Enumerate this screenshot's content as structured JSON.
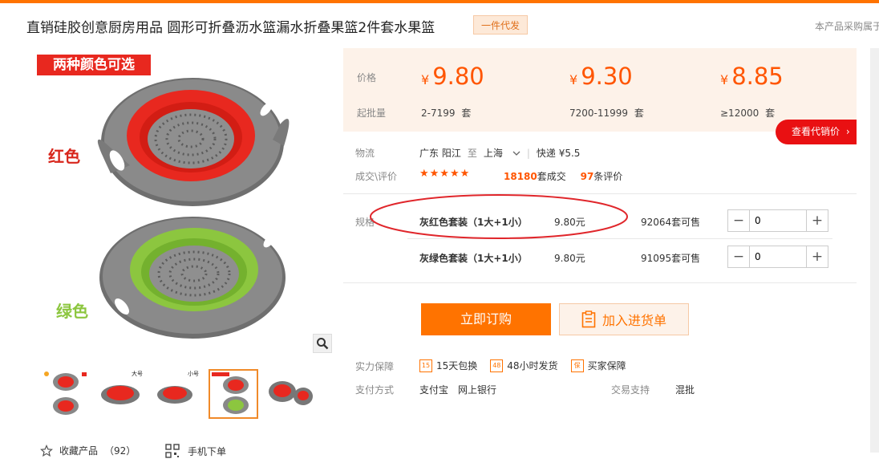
{
  "header": {
    "title": "直销硅胶创意厨房用品 圆形可折叠沥水篮漏水折叠果篮2件套水果篮",
    "badge": "一件代发",
    "notice": "本产品采购属于"
  },
  "gallery": {
    "banner": "两种颜色可选",
    "label_red": "红色",
    "label_green": "绿色",
    "thumbs": [
      {
        "name": "thumb-1",
        "active": false
      },
      {
        "name": "thumb-2",
        "caption": "大号",
        "active": false
      },
      {
        "name": "thumb-3",
        "caption": "小号",
        "active": false
      },
      {
        "name": "thumb-4",
        "active": true
      },
      {
        "name": "thumb-5",
        "active": false
      }
    ],
    "favorite_label": "收藏产品",
    "favorite_count": "（92）",
    "mobile_label": "手机下单"
  },
  "pricing": {
    "price_label": "价格",
    "moq_label": "起批量",
    "currency": "¥",
    "tiers": [
      {
        "price": "9.80",
        "qty": "2-7199",
        "unit": "套"
      },
      {
        "price": "9.30",
        "qty": "7200-11999",
        "unit": "套"
      },
      {
        "price": "8.85",
        "qty": "≥12000",
        "unit": "套"
      }
    ],
    "agent_button": "查看代销价"
  },
  "logistics": {
    "label": "物流",
    "from": "广东 阳江",
    "to_word": "至",
    "to": "上海",
    "express": "快递 ¥5.5"
  },
  "reviews": {
    "label": "成交\\评价",
    "stars": "★★★★★",
    "deals_count": "18180",
    "deals_suffix": "套成交",
    "review_count": "97",
    "review_suffix": "条评价"
  },
  "sku": {
    "label": "规格",
    "rows": [
      {
        "name": "灰红色套装（1大+1小）",
        "price": "9.80元",
        "stock": "92064套可售",
        "qty": "0"
      },
      {
        "name": "灰绿色套装（1大+1小）",
        "price": "9.80元",
        "stock": "91095套可售",
        "qty": "0"
      }
    ]
  },
  "actions": {
    "buy_now": "立即订购",
    "add_to_cart": "加入进货单"
  },
  "guarantee": {
    "label": "实力保障",
    "items": [
      {
        "icon_text": "15",
        "label": "15天包换"
      },
      {
        "icon_text": "48",
        "label": "48小时发货"
      },
      {
        "icon_text": "保",
        "label": "买家保障"
      }
    ]
  },
  "payment": {
    "label": "支付方式",
    "methods": [
      "支付宝",
      "网上银行"
    ],
    "trade_label": "交易支持",
    "trade_value": "混批"
  },
  "colors": {
    "accent": "#ff7300",
    "price": "#ff5500",
    "agent_red": "#e91012",
    "annotation_red": "#e0262b"
  }
}
